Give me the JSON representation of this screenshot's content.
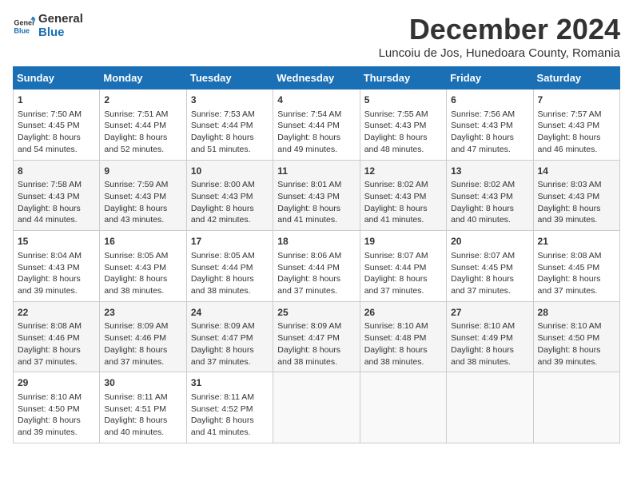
{
  "header": {
    "logo_line1": "General",
    "logo_line2": "Blue",
    "month_title": "December 2024",
    "location": "Luncoiu de Jos, Hunedoara County, Romania"
  },
  "days_of_week": [
    "Sunday",
    "Monday",
    "Tuesday",
    "Wednesday",
    "Thursday",
    "Friday",
    "Saturday"
  ],
  "weeks": [
    [
      {
        "day": "1",
        "lines": [
          "Sunrise: 7:50 AM",
          "Sunset: 4:45 PM",
          "Daylight: 8 hours",
          "and 54 minutes."
        ]
      },
      {
        "day": "2",
        "lines": [
          "Sunrise: 7:51 AM",
          "Sunset: 4:44 PM",
          "Daylight: 8 hours",
          "and 52 minutes."
        ]
      },
      {
        "day": "3",
        "lines": [
          "Sunrise: 7:53 AM",
          "Sunset: 4:44 PM",
          "Daylight: 8 hours",
          "and 51 minutes."
        ]
      },
      {
        "day": "4",
        "lines": [
          "Sunrise: 7:54 AM",
          "Sunset: 4:44 PM",
          "Daylight: 8 hours",
          "and 49 minutes."
        ]
      },
      {
        "day": "5",
        "lines": [
          "Sunrise: 7:55 AM",
          "Sunset: 4:43 PM",
          "Daylight: 8 hours",
          "and 48 minutes."
        ]
      },
      {
        "day": "6",
        "lines": [
          "Sunrise: 7:56 AM",
          "Sunset: 4:43 PM",
          "Daylight: 8 hours",
          "and 47 minutes."
        ]
      },
      {
        "day": "7",
        "lines": [
          "Sunrise: 7:57 AM",
          "Sunset: 4:43 PM",
          "Daylight: 8 hours",
          "and 46 minutes."
        ]
      }
    ],
    [
      {
        "day": "8",
        "lines": [
          "Sunrise: 7:58 AM",
          "Sunset: 4:43 PM",
          "Daylight: 8 hours",
          "and 44 minutes."
        ]
      },
      {
        "day": "9",
        "lines": [
          "Sunrise: 7:59 AM",
          "Sunset: 4:43 PM",
          "Daylight: 8 hours",
          "and 43 minutes."
        ]
      },
      {
        "day": "10",
        "lines": [
          "Sunrise: 8:00 AM",
          "Sunset: 4:43 PM",
          "Daylight: 8 hours",
          "and 42 minutes."
        ]
      },
      {
        "day": "11",
        "lines": [
          "Sunrise: 8:01 AM",
          "Sunset: 4:43 PM",
          "Daylight: 8 hours",
          "and 41 minutes."
        ]
      },
      {
        "day": "12",
        "lines": [
          "Sunrise: 8:02 AM",
          "Sunset: 4:43 PM",
          "Daylight: 8 hours",
          "and 41 minutes."
        ]
      },
      {
        "day": "13",
        "lines": [
          "Sunrise: 8:02 AM",
          "Sunset: 4:43 PM",
          "Daylight: 8 hours",
          "and 40 minutes."
        ]
      },
      {
        "day": "14",
        "lines": [
          "Sunrise: 8:03 AM",
          "Sunset: 4:43 PM",
          "Daylight: 8 hours",
          "and 39 minutes."
        ]
      }
    ],
    [
      {
        "day": "15",
        "lines": [
          "Sunrise: 8:04 AM",
          "Sunset: 4:43 PM",
          "Daylight: 8 hours",
          "and 39 minutes."
        ]
      },
      {
        "day": "16",
        "lines": [
          "Sunrise: 8:05 AM",
          "Sunset: 4:43 PM",
          "Daylight: 8 hours",
          "and 38 minutes."
        ]
      },
      {
        "day": "17",
        "lines": [
          "Sunrise: 8:05 AM",
          "Sunset: 4:44 PM",
          "Daylight: 8 hours",
          "and 38 minutes."
        ]
      },
      {
        "day": "18",
        "lines": [
          "Sunrise: 8:06 AM",
          "Sunset: 4:44 PM",
          "Daylight: 8 hours",
          "and 37 minutes."
        ]
      },
      {
        "day": "19",
        "lines": [
          "Sunrise: 8:07 AM",
          "Sunset: 4:44 PM",
          "Daylight: 8 hours",
          "and 37 minutes."
        ]
      },
      {
        "day": "20",
        "lines": [
          "Sunrise: 8:07 AM",
          "Sunset: 4:45 PM",
          "Daylight: 8 hours",
          "and 37 minutes."
        ]
      },
      {
        "day": "21",
        "lines": [
          "Sunrise: 8:08 AM",
          "Sunset: 4:45 PM",
          "Daylight: 8 hours",
          "and 37 minutes."
        ]
      }
    ],
    [
      {
        "day": "22",
        "lines": [
          "Sunrise: 8:08 AM",
          "Sunset: 4:46 PM",
          "Daylight: 8 hours",
          "and 37 minutes."
        ]
      },
      {
        "day": "23",
        "lines": [
          "Sunrise: 8:09 AM",
          "Sunset: 4:46 PM",
          "Daylight: 8 hours",
          "and 37 minutes."
        ]
      },
      {
        "day": "24",
        "lines": [
          "Sunrise: 8:09 AM",
          "Sunset: 4:47 PM",
          "Daylight: 8 hours",
          "and 37 minutes."
        ]
      },
      {
        "day": "25",
        "lines": [
          "Sunrise: 8:09 AM",
          "Sunset: 4:47 PM",
          "Daylight: 8 hours",
          "and 38 minutes."
        ]
      },
      {
        "day": "26",
        "lines": [
          "Sunrise: 8:10 AM",
          "Sunset: 4:48 PM",
          "Daylight: 8 hours",
          "and 38 minutes."
        ]
      },
      {
        "day": "27",
        "lines": [
          "Sunrise: 8:10 AM",
          "Sunset: 4:49 PM",
          "Daylight: 8 hours",
          "and 38 minutes."
        ]
      },
      {
        "day": "28",
        "lines": [
          "Sunrise: 8:10 AM",
          "Sunset: 4:50 PM",
          "Daylight: 8 hours",
          "and 39 minutes."
        ]
      }
    ],
    [
      {
        "day": "29",
        "lines": [
          "Sunrise: 8:10 AM",
          "Sunset: 4:50 PM",
          "Daylight: 8 hours",
          "and 39 minutes."
        ]
      },
      {
        "day": "30",
        "lines": [
          "Sunrise: 8:11 AM",
          "Sunset: 4:51 PM",
          "Daylight: 8 hours",
          "and 40 minutes."
        ]
      },
      {
        "day": "31",
        "lines": [
          "Sunrise: 8:11 AM",
          "Sunset: 4:52 PM",
          "Daylight: 8 hours",
          "and 41 minutes."
        ]
      },
      null,
      null,
      null,
      null
    ]
  ]
}
